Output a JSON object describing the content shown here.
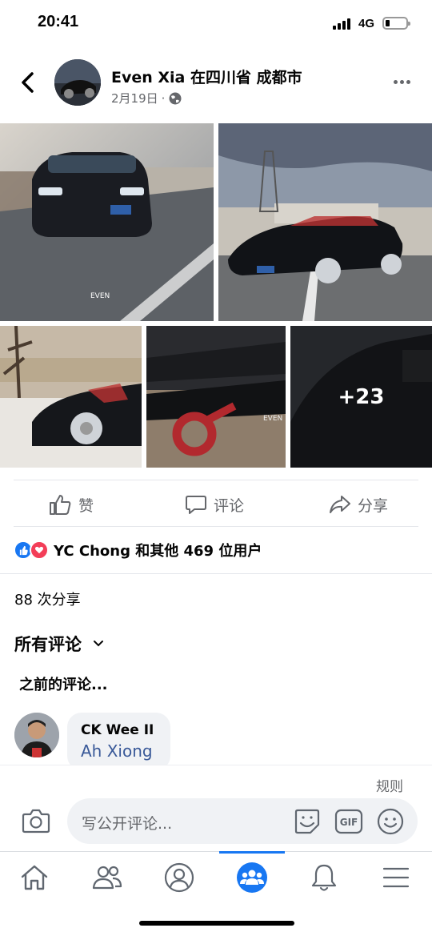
{
  "status_bar": {
    "time": "20:41",
    "network": "4G",
    "battery_level": 0.2
  },
  "post": {
    "author": "Even Xia",
    "location": "在四川省 成都市",
    "date": "2月19日",
    "separator": "·",
    "privacy_icon": "globe-icon",
    "more_photos_label": "+23",
    "watermark_1": "EVEN",
    "watermark_2": "EVEN"
  },
  "actions": {
    "like": "赞",
    "comment": "评论",
    "share": "分享"
  },
  "reactions": {
    "text": "YC Chong 和其他 469 位用户",
    "like_color": "#1877f2",
    "love_color": "#f33e58"
  },
  "shares": "88 次分享",
  "comments_filter": "所有评论",
  "previous_comments": "之前的评论...",
  "comment": {
    "author": "CK Wee II",
    "text": "Ah Xiong"
  },
  "composer": {
    "rules": "规则",
    "placeholder": "写公开评论...",
    "gif_label": "GIF"
  },
  "tabbar": {
    "active_tab": "groups",
    "accent": "#1877f2"
  }
}
